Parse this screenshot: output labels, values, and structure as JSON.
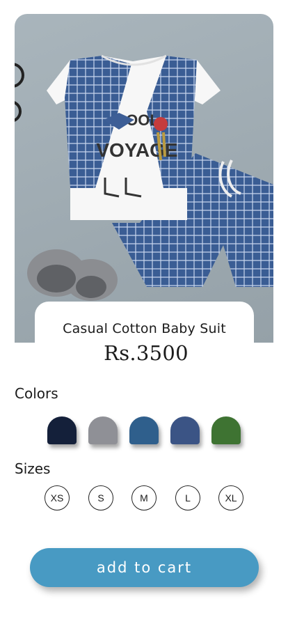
{
  "product": {
    "name": "Casual Cotton Baby Suit",
    "price": "Rs.3500"
  },
  "colors": {
    "label": "Colors",
    "options": [
      {
        "name": "navy",
        "hex": "#14203a"
      },
      {
        "name": "gray",
        "hex": "#8f9096"
      },
      {
        "name": "steel-blue",
        "hex": "#2f5f8c"
      },
      {
        "name": "slate-blue",
        "hex": "#3b5485"
      },
      {
        "name": "green",
        "hex": "#3e7332"
      }
    ]
  },
  "sizes": {
    "label": "Sizes",
    "options": [
      "XS",
      "S",
      "M",
      "L",
      "XL"
    ]
  },
  "cart_button": {
    "label": "add to cart",
    "color": "#489ac3"
  },
  "hero_image": {
    "shirt_text_line1": "COOL",
    "shirt_text_line2": "VOYAGE"
  }
}
